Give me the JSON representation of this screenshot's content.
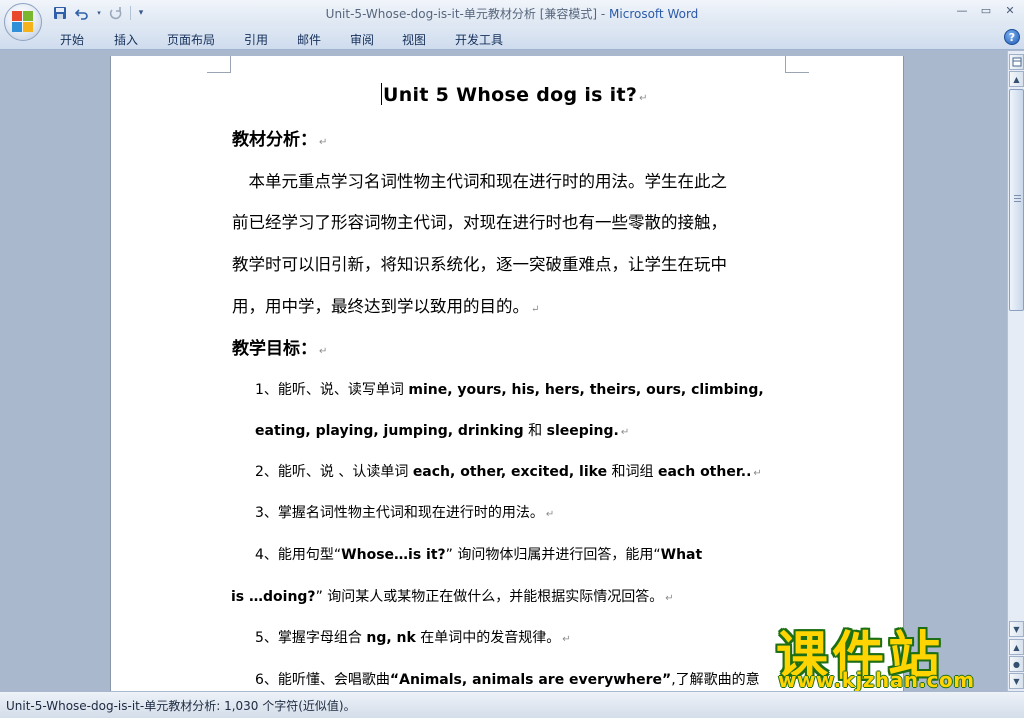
{
  "window": {
    "title_doc": "Unit-5-Whose-dog-is-it-单元教材分析 [兼容模式]",
    "title_sep": " - ",
    "title_app": "Microsoft Word",
    "minimize": "—",
    "restore": "▭",
    "close": "✕"
  },
  "qat": {
    "save_icon": "save-icon",
    "undo_icon": "undo-icon",
    "redo_icon": "redo-icon",
    "customize_icon": "customize-qat-icon"
  },
  "ribbon": {
    "tabs": [
      "开始",
      "插入",
      "页面布局",
      "引用",
      "邮件",
      "审阅",
      "视图",
      "开发工具"
    ],
    "help": "?"
  },
  "document": {
    "title": "Unit 5 Whose dog is it?",
    "para_mark": "↵",
    "section1_heading": "教材分析：",
    "section1_lines": [
      "　本单元重点学习名词性物主代词和现在进行时的用法。学生在此之",
      "前已经学习了形容词物主代词，对现在进行时也有一些零散的接触，",
      "教学时可以旧引新，将知识系统化，逐一突破重难点，让学生在玩中",
      "用，用中学，最终达到学以致用的目的。"
    ],
    "section2_heading": "教学目标：",
    "objectives": {
      "o1a_cn": "1、能听、说、读写单词 ",
      "o1a_en": "mine, yours, his, hers, theirs, ours, climbing,",
      "o1b_en1": "eating, playing, jumping, drinking",
      "o1b_cn": " 和 ",
      "o1b_en2": "sleeping.",
      "o2_cn1": "2、能听、说 、认读单词 ",
      "o2_en1": "each, other, excited, like",
      "o2_cn2": " 和词组 ",
      "o2_en2": "each other..",
      "o3": "3、掌握名词性物主代词和现在进行时的用法。",
      "o4a_cn1": "4、能用句型“",
      "o4a_en1": "Whose…is it?",
      "o4a_cn2": "” 询问物体归属并进行回答，能用“",
      "o4a_en2": "What",
      "o4b_en": "is …doing?",
      "o4b_cn": "” 询问某人或某物正在做什么，并能根据实际情况回答。",
      "o5_cn1": "5、掌握字母组合 ",
      "o5_en": "ng, nk",
      "o5_cn2": " 在单词中的发音规律。",
      "o6_cn1": "6、能听懂、会唱歌曲",
      "o6_en": "“Animals, animals are everywhere”",
      "o6_cn2": ",了解歌曲的意"
    }
  },
  "watermark": {
    "name": "课件站",
    "url": "www.kjzhan.com"
  },
  "statusbar": {
    "text": "Unit-5-Whose-dog-is-it-单元教材分析: 1,030 个字符(近似值)。"
  }
}
